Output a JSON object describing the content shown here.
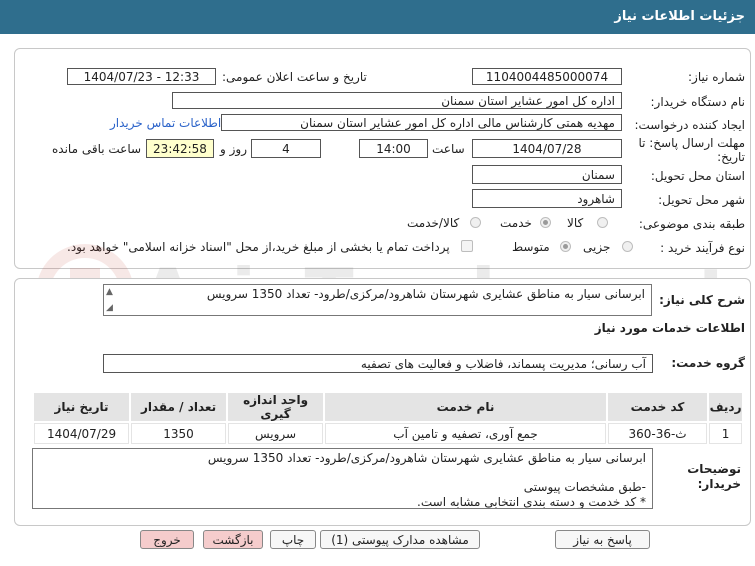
{
  "header": {
    "title": "جزئیات اطلاعات نیاز"
  },
  "form": {
    "need_number_label": "شماره نیاز:",
    "need_number": "1104004485000074",
    "announce_label": "تاریخ و ساعت اعلان عمومی:",
    "announce_value": "1404/07/23 - 12:33",
    "buyer_label": "نام دستگاه خریدار:",
    "buyer_value": "اداره کل امور عشایر استان سمنان",
    "creator_label": "ایجاد کننده درخواست:",
    "creator_value": "مهدیه همتی کارشناس مالی اداره کل امور عشایر استان سمنان",
    "contact_link": "اطلاعات تماس خریدار",
    "deadline_label_1": "مهلت ارسال پاسخ: تا",
    "deadline_label_2": "تاریخ:",
    "deadline_date": "1404/07/28",
    "time_label": "ساعت",
    "deadline_time": "14:00",
    "days_value": "4",
    "days_label": "روز و",
    "remaining_value": "23:42:58",
    "remaining_label": "ساعت باقی مانده",
    "province_label": "استان محل تحویل:",
    "province_value": "سمنان",
    "city_label": "شهر محل تحویل:",
    "city_value": "شاهرود",
    "category_label": "طبقه بندی موضوعی:",
    "category_options": [
      "کالا",
      "خدمت",
      "کالا/خدمت"
    ],
    "category_selected": "خدمت",
    "process_label": "نوع فرآیند خرید :",
    "process_options": [
      "جزیی",
      "متوسط"
    ],
    "process_selected": "متوسط",
    "payment_note": "پرداخت تمام یا بخشی از مبلغ خرید،از محل \"اسناد خزانه اسلامی\" خواهد بود."
  },
  "summary": {
    "label": "شرح کلی نیاز:",
    "value": "ابرسانی سیار به مناطق عشایری شهرستان شاهرود/مرکزی/طرود- تعداد 1350 سرویس"
  },
  "services": {
    "section_title": "اطلاعات خدمات مورد نیاز",
    "group_label": "گروه خدمت:",
    "group_value": "آب رسانی؛ مدیریت پسماند، فاضلاب و فعالیت های تصفیه",
    "columns": [
      "ردیف",
      "کد خدمت",
      "نام خدمت",
      "واحد اندازه گیری",
      "تعداد / مقدار",
      "تاریخ نیاز"
    ],
    "rows": [
      {
        "index": "1",
        "code": "ث-36-360",
        "name": "جمع آوری، تصفیه و تامین آب",
        "unit": "سرویس",
        "qty": "1350",
        "date": "1404/07/29"
      }
    ]
  },
  "notes": {
    "label_1": "توضیحات",
    "label_2": "خریدار:",
    "line1": "ابرسانی سیار به مناطق عشایری شهرستان شاهرود/مرکزی/طرود- تعداد 1350 سرویس",
    "line2": "-طبق مشخصات پیوستی",
    "line3": "* کد خدمت و دسته بندی انتخابی مشابه است."
  },
  "buttons": {
    "reply": "پاسخ به نیاز",
    "attachments": "مشاهده مدارک پیوستی (1)",
    "print": "چاپ",
    "back": "بازگشت",
    "exit": "خروج"
  },
  "watermark": {
    "text": "AriaTender.net"
  },
  "colors": {
    "header": "#2f6e8d",
    "link": "#2a62c9",
    "yellow": "#ffffcc",
    "pink_button": "#f5cccc"
  }
}
